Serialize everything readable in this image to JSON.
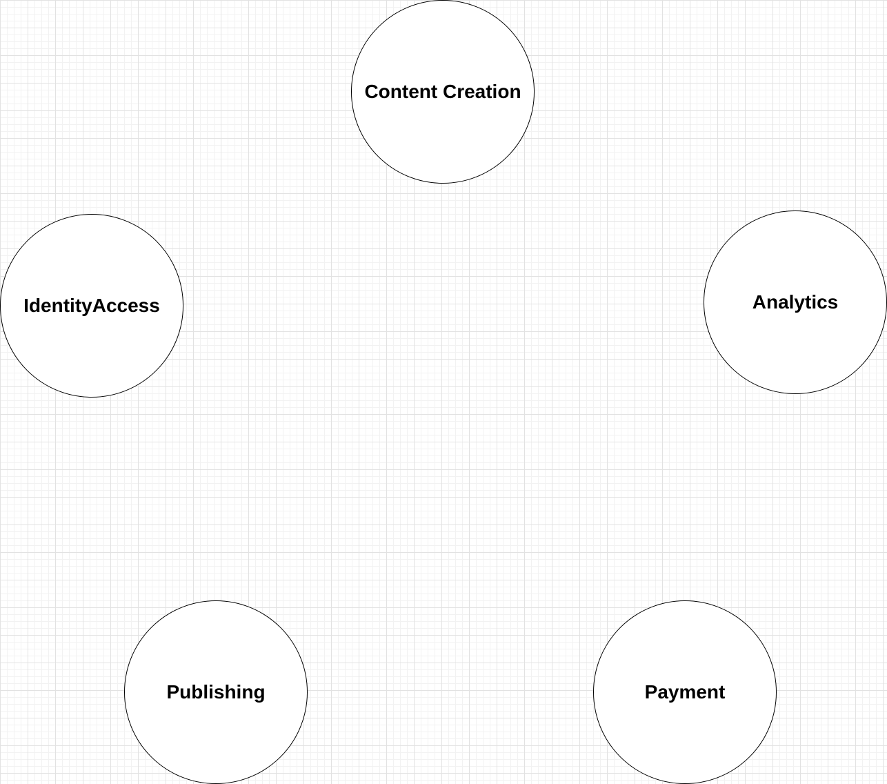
{
  "diagram": {
    "nodes": [
      {
        "id": "content-creation",
        "label": "Content Creation",
        "shape": "circle"
      },
      {
        "id": "identity-access",
        "label": "IdentityAccess",
        "shape": "circle"
      },
      {
        "id": "analytics",
        "label": "Analytics",
        "shape": "circle"
      },
      {
        "id": "publishing",
        "label": "Publishing",
        "shape": "circle"
      },
      {
        "id": "payment",
        "label": "Payment",
        "shape": "circle"
      }
    ],
    "colors": {
      "background": "#ffffff",
      "grid": "#e2e2e2",
      "node_fill": "#ffffff",
      "node_stroke": "#000000",
      "text": "#000000"
    }
  }
}
